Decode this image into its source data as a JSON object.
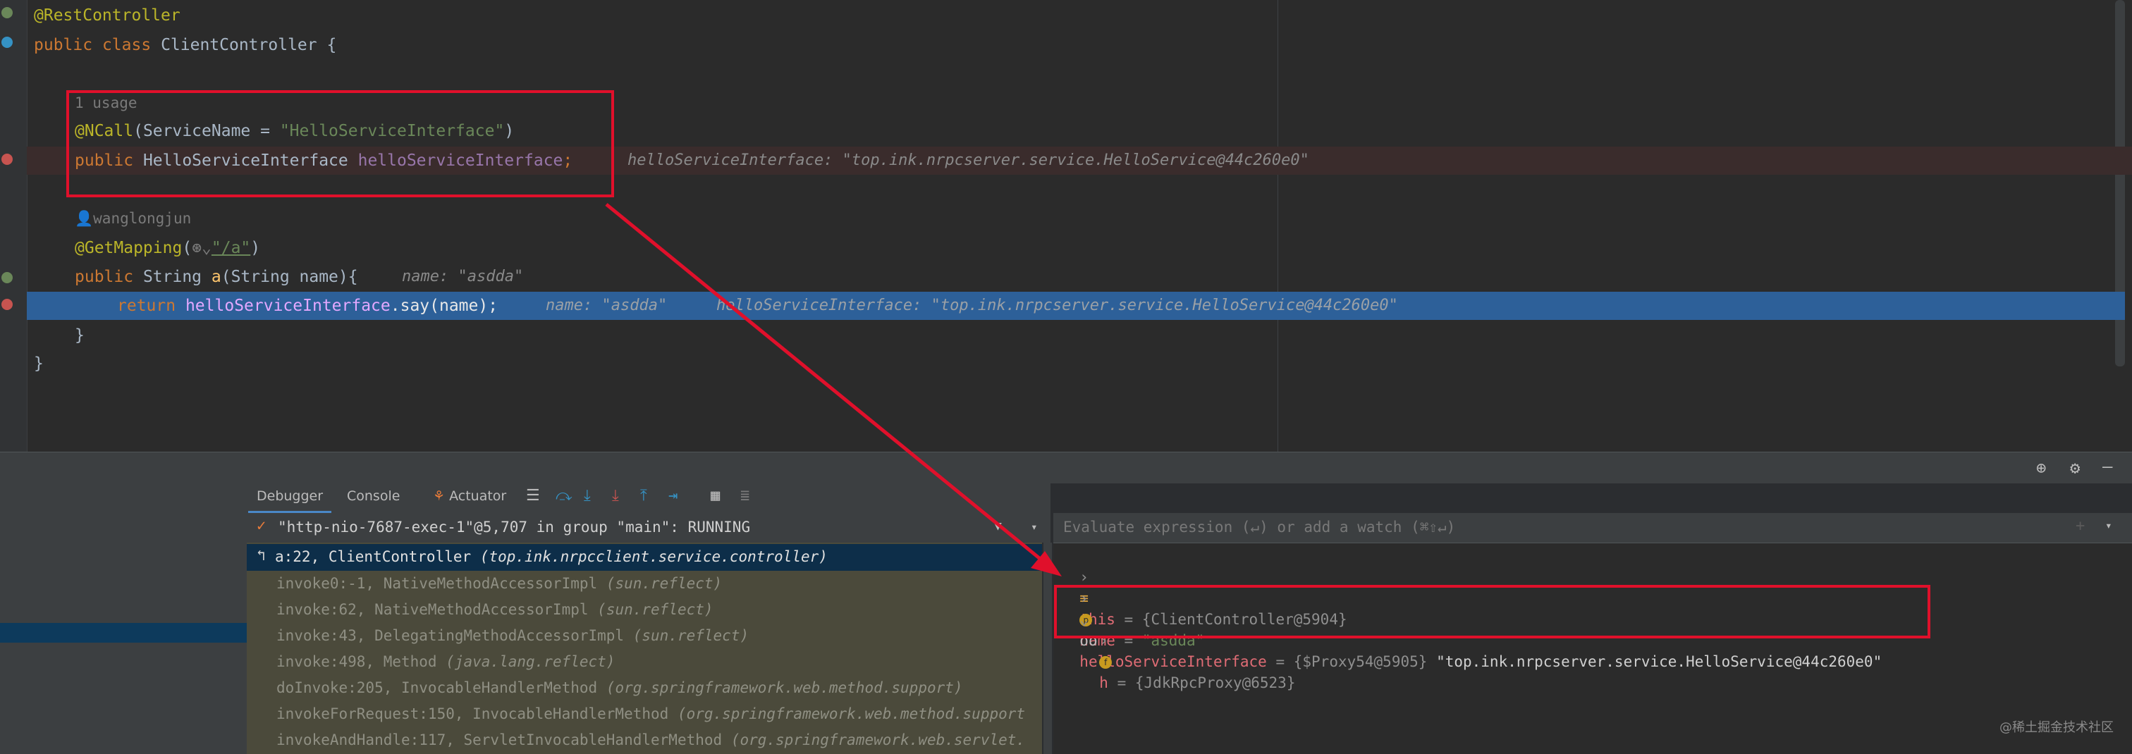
{
  "editor": {
    "line1": {
      "annotation": "@RestController"
    },
    "line2": {
      "kw1": "public",
      "kw2": "class",
      "name": "ClientController {"
    },
    "usage1": "1 usage",
    "line4": {
      "annotation": "@NCall",
      "open": "(ServiceName = ",
      "string": "\"HelloServiceInterface\"",
      "close": ")"
    },
    "line5": {
      "kw": "public",
      "type": " HelloServiceInterface ",
      "field": "helloServiceInterface",
      "semi": ";",
      "hint": "helloServiceInterface: \"top.ink.nrpcserver.service.HelloService@44c260e0\""
    },
    "author": "wanglongjun",
    "line7": {
      "annotation": "@GetMapping",
      "open": "(",
      "path": "\"/a\"",
      "close": ")"
    },
    "line8": {
      "kw": "public",
      "sig": " String ",
      "fn": "a",
      "params": "(String name){",
      "hint": "name: \"asdda\""
    },
    "line9": {
      "kw": "return",
      "field": "helloServiceInterface",
      "call": ".say(name);",
      "hint1": "name: \"asdda\"",
      "hint2": "helloServiceInterface: \"top.ink.nrpcserver.service.HelloService@44c260e0\""
    },
    "line10": "}",
    "line11": "}"
  },
  "debugger": {
    "tabs": [
      "Debugger",
      "Console",
      "Actuator"
    ],
    "thread": "\"http-nio-7687-exec-1\"@5,707 in group \"main\": RUNNING",
    "current_frame": {
      "method": "a:22, ClientController",
      "pkg": "(top.ink.nrpcclient.service.controller)"
    },
    "frames": [
      {
        "method": "invoke0:-1, NativeMethodAccessorImpl",
        "pkg": "(sun.reflect)"
      },
      {
        "method": "invoke:62, NativeMethodAccessorImpl",
        "pkg": "(sun.reflect)"
      },
      {
        "method": "invoke:43, DelegatingMethodAccessorImpl",
        "pkg": "(sun.reflect)"
      },
      {
        "method": "invoke:498, Method",
        "pkg": "(java.lang.reflect)"
      },
      {
        "method": "doInvoke:205, InvocableHandlerMethod",
        "pkg": "(org.springframework.web.method.support)"
      },
      {
        "method": "invokeForRequest:150, InvocableHandlerMethod",
        "pkg": "(org.springframework.web.method.support"
      },
      {
        "method": "invokeAndHandle:117, ServletInvocableHandlerMethod",
        "pkg": "(org.springframework.web.servlet."
      }
    ],
    "eval_placeholder": "Evaluate expression (↵) or add a watch (⌘⇧↵)",
    "variables": [
      {
        "name": "this",
        "value": "{ClientController@5904}"
      },
      {
        "name": "name",
        "value": "\"asdda\""
      },
      {
        "name": "helloServiceInterface",
        "value": "{$Proxy54@5905}",
        "str": "\"top.ink.nrpcserver.service.HelloService@44c260e0\""
      },
      {
        "name": "h",
        "value": "{JdkRpcProxy@6523}"
      }
    ]
  },
  "watermark": "@稀土掘金技术社区",
  "colors": {
    "highlight": "#e0102b",
    "current_line": "#2d6099"
  }
}
